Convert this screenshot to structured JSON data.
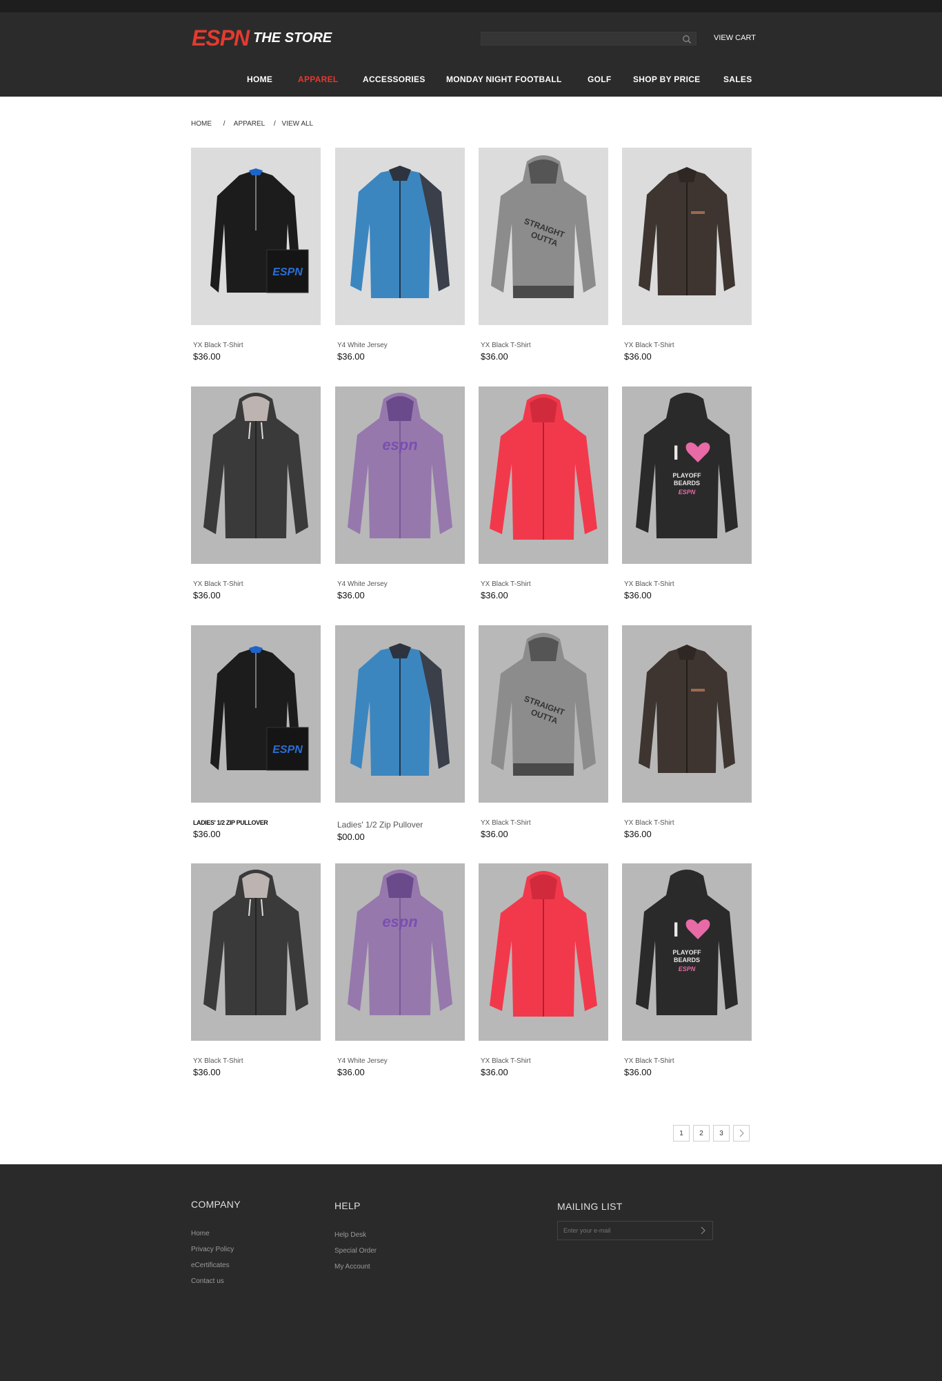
{
  "header": {
    "logo_mark": "ESPN",
    "logo_text": "THE STORE",
    "search_placeholder": "",
    "view_cart": "VIEW CART",
    "nav": [
      {
        "label": "HOME",
        "active": false
      },
      {
        "label": "APPAREL",
        "active": true
      },
      {
        "label": "ACCESSORIES",
        "active": false
      },
      {
        "label": "MONDAY NIGHT FOOTBALL",
        "active": false
      },
      {
        "label": "GOLF",
        "active": false
      },
      {
        "label": "SHOP BY PRICE",
        "active": false
      },
      {
        "label": "SALES",
        "active": false
      }
    ]
  },
  "breadcrumb": {
    "home": "HOME",
    "sep1": "/",
    "apparel": "APPAREL",
    "sep2": "/",
    "current": "VIEW ALL"
  },
  "products": [
    {
      "name": "YX  Black T-Shirt",
      "price": "$36.00",
      "item": "black half-zip pullover",
      "bg": "#dcdcdc"
    },
    {
      "name": "Y4  White Jersey",
      "price": "$36.00",
      "item": "blue fleece jacket",
      "bg": "#dcdcdc"
    },
    {
      "name": "YX  Black T-Shirt",
      "price": "$36.00",
      "item": "grey graphic hoodie",
      "bg": "#dcdcdc"
    },
    {
      "name": "YX  Black T-Shirt",
      "price": "$36.00",
      "item": "brown softshell jacket",
      "bg": "#dcdcdc"
    },
    {
      "name": "YX  Black T-Shirt",
      "price": "$36.00",
      "item": "charcoal zip hoodie",
      "bg": "#b8b8b8"
    },
    {
      "name": "Y4  White Jersey",
      "price": "$36.00",
      "item": "purple espn zip hoodie",
      "bg": "#b8b8b8"
    },
    {
      "name": "YX  Black T-Shirt",
      "price": "$36.00",
      "item": "red zip hoodie",
      "bg": "#b8b8b8"
    },
    {
      "name": "YX  Black T-Shirt",
      "price": "$36.00",
      "item": "black heart graphic hoodie",
      "bg": "#b8b8b8"
    },
    {
      "name": "LADIES' 1/2 ZIP PULLOVER",
      "price": "$36.00",
      "item": "black half-zip pullover",
      "bg": "#b8b8b8",
      "style": "bold"
    },
    {
      "name": "Ladies' 1/2 Zip Pullover",
      "price": "$00.00",
      "item": "blue fleece jacket",
      "bg": "#b8b8b8",
      "style": "large"
    },
    {
      "name": "YX  Black T-Shirt",
      "price": "$36.00",
      "item": "grey graphic hoodie",
      "bg": "#b8b8b8"
    },
    {
      "name": "YX  Black T-Shirt",
      "price": "$36.00",
      "item": "brown softshell jacket",
      "bg": "#b8b8b8"
    },
    {
      "name": "YX  Black T-Shirt",
      "price": "$36.00",
      "item": "charcoal zip hoodie",
      "bg": "#b8b8b8"
    },
    {
      "name": "Y4  White Jersey",
      "price": "$36.00",
      "item": "purple espn zip hoodie",
      "bg": "#b8b8b8"
    },
    {
      "name": "YX  Black T-Shirt",
      "price": "$36.00",
      "item": "red zip hoodie",
      "bg": "#b8b8b8"
    },
    {
      "name": "YX  Black T-Shirt",
      "price": "$36.00",
      "item": "black heart graphic hoodie",
      "bg": "#b8b8b8"
    }
  ],
  "pagination": {
    "pages": [
      "1",
      "2",
      "3"
    ],
    "next_icon": "chevron-right-icon"
  },
  "footer": {
    "company": {
      "heading": "COMPANY",
      "links": [
        "Home",
        "Privacy Policy",
        "eCertificates",
        "Contact us"
      ]
    },
    "help": {
      "heading": "HELP",
      "links": [
        "Help Desk",
        "Special Order",
        "My Account"
      ]
    },
    "mailing": {
      "heading": "MAILING LIST",
      "placeholder": "Enter your e-mail"
    }
  },
  "colors": {
    "brand_red": "#e43a2f",
    "header_bg": "#2b2b2b",
    "footer_bg": "#2a2a2a"
  }
}
